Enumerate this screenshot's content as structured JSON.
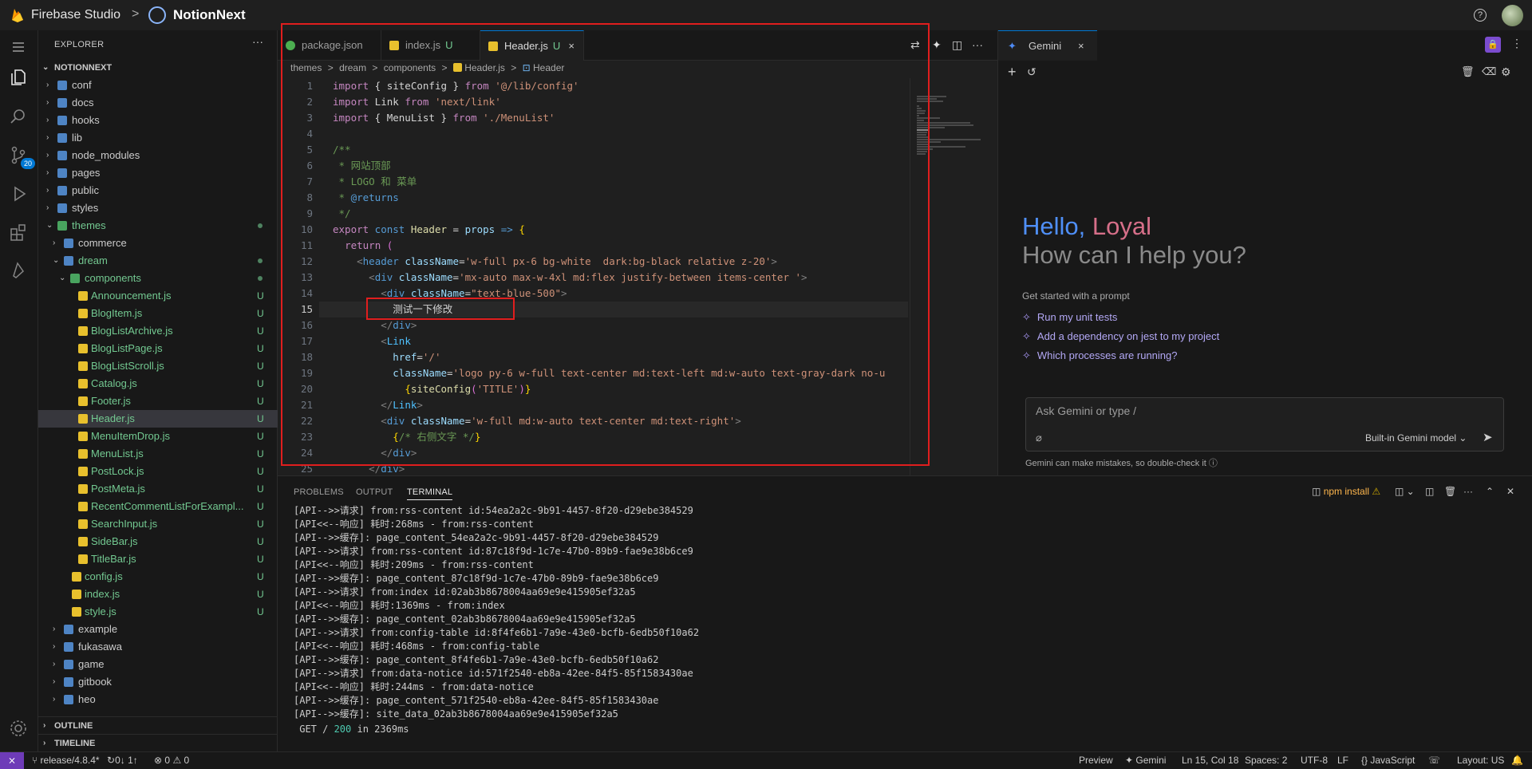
{
  "titlebar": {
    "brand": "Firebase Studio",
    "separator": ">",
    "project": "NotionNext",
    "help_icon": "help-circle-icon"
  },
  "explorer": {
    "header": "EXPLORER",
    "root": "NOTIONNEXT",
    "items": [
      {
        "label": "conf",
        "type": "folder",
        "depth": 1,
        "open": false,
        "status": ""
      },
      {
        "label": "docs",
        "type": "folder",
        "depth": 1,
        "open": false,
        "status": ""
      },
      {
        "label": "hooks",
        "type": "folder",
        "depth": 1,
        "open": false,
        "status": ""
      },
      {
        "label": "lib",
        "type": "folder",
        "depth": 1,
        "open": false,
        "status": ""
      },
      {
        "label": "node_modules",
        "type": "folder",
        "depth": 1,
        "open": false,
        "status": ""
      },
      {
        "label": "pages",
        "type": "folder",
        "depth": 1,
        "open": false,
        "status": ""
      },
      {
        "label": "public",
        "type": "folder",
        "depth": 1,
        "open": false,
        "status": ""
      },
      {
        "label": "styles",
        "type": "folder",
        "depth": 1,
        "open": false,
        "status": ""
      },
      {
        "label": "themes",
        "type": "folder",
        "depth": 1,
        "open": true,
        "status": "dot"
      },
      {
        "label": "commerce",
        "type": "folder",
        "depth": 2,
        "open": false,
        "status": ""
      },
      {
        "label": "dream",
        "type": "folder",
        "depth": 2,
        "open": true,
        "status": "dot"
      },
      {
        "label": "components",
        "type": "folder",
        "depth": 3,
        "open": true,
        "status": "dot"
      },
      {
        "label": "Announcement.js",
        "type": "js",
        "depth": 4,
        "status": "U"
      },
      {
        "label": "BlogItem.js",
        "type": "js",
        "depth": 4,
        "status": "U"
      },
      {
        "label": "BlogListArchive.js",
        "type": "js",
        "depth": 4,
        "status": "U"
      },
      {
        "label": "BlogListPage.js",
        "type": "js",
        "depth": 4,
        "status": "U"
      },
      {
        "label": "BlogListScroll.js",
        "type": "js",
        "depth": 4,
        "status": "U"
      },
      {
        "label": "Catalog.js",
        "type": "js",
        "depth": 4,
        "status": "U"
      },
      {
        "label": "Footer.js",
        "type": "js",
        "depth": 4,
        "status": "U"
      },
      {
        "label": "Header.js",
        "type": "js",
        "depth": 4,
        "status": "U",
        "selected": true
      },
      {
        "label": "MenuItemDrop.js",
        "type": "js",
        "depth": 4,
        "status": "U"
      },
      {
        "label": "MenuList.js",
        "type": "js",
        "depth": 4,
        "status": "U"
      },
      {
        "label": "PostLock.js",
        "type": "js",
        "depth": 4,
        "status": "U"
      },
      {
        "label": "PostMeta.js",
        "type": "js",
        "depth": 4,
        "status": "U"
      },
      {
        "label": "RecentCommentListForExampl...",
        "type": "js",
        "depth": 4,
        "status": "U"
      },
      {
        "label": "SearchInput.js",
        "type": "js",
        "depth": 4,
        "status": "U"
      },
      {
        "label": "SideBar.js",
        "type": "js",
        "depth": 4,
        "status": "U"
      },
      {
        "label": "TitleBar.js",
        "type": "js",
        "depth": 4,
        "status": "U"
      },
      {
        "label": "config.js",
        "type": "js",
        "depth": 3,
        "status": "U"
      },
      {
        "label": "index.js",
        "type": "js",
        "depth": 3,
        "status": "U"
      },
      {
        "label": "style.js",
        "type": "js",
        "depth": 3,
        "status": "U"
      },
      {
        "label": "example",
        "type": "folder",
        "depth": 2,
        "open": false,
        "status": ""
      },
      {
        "label": "fukasawa",
        "type": "folder",
        "depth": 2,
        "open": false,
        "status": ""
      },
      {
        "label": "game",
        "type": "folder",
        "depth": 2,
        "open": false,
        "status": ""
      },
      {
        "label": "gitbook",
        "type": "folder",
        "depth": 2,
        "open": false,
        "status": ""
      },
      {
        "label": "heo",
        "type": "folder",
        "depth": 2,
        "open": false,
        "status": ""
      }
    ],
    "outline": "OUTLINE",
    "timeline": "TIMELINE",
    "scm_badge": "20"
  },
  "editor": {
    "tabs": [
      {
        "label": "package.json",
        "badge": "",
        "active": false
      },
      {
        "label": "index.js",
        "badge": "U",
        "active": false
      },
      {
        "label": "Header.js",
        "badge": "U",
        "active": true,
        "close": "×"
      }
    ],
    "breadcrumb": [
      "themes",
      "dream",
      "components",
      "Header.js",
      "Header"
    ],
    "breadcrumb_sep": ">",
    "current_line": 15,
    "lines": [
      [
        [
          "kw",
          "import"
        ],
        [
          "pl",
          " { siteConfig } "
        ],
        [
          "kw",
          "from"
        ],
        [
          "str",
          " '@/lib/config'"
        ]
      ],
      [
        [
          "kw",
          "import"
        ],
        [
          "pl",
          " Link "
        ],
        [
          "kw",
          "from"
        ],
        [
          "str",
          " 'next/link'"
        ]
      ],
      [
        [
          "kw",
          "import"
        ],
        [
          "pl",
          " { MenuList } "
        ],
        [
          "kw",
          "from"
        ],
        [
          "str",
          " './MenuList'"
        ]
      ],
      [],
      [
        [
          "cm",
          "/**"
        ]
      ],
      [
        [
          "cm",
          " * 网站顶部"
        ]
      ],
      [
        [
          "cm",
          " * LOGO 和 菜单"
        ]
      ],
      [
        [
          "cm",
          " * "
        ],
        [
          "kw2",
          "@returns"
        ]
      ],
      [
        [
          "cm",
          " */"
        ]
      ],
      [
        [
          "kw",
          "export"
        ],
        [
          "kw2",
          " const"
        ],
        [
          "fn",
          " Header"
        ],
        [
          "pl",
          " = "
        ],
        [
          "attr",
          "props"
        ],
        [
          "kw2",
          " =>"
        ],
        [
          "pl",
          " "
        ],
        [
          "br",
          "{"
        ]
      ],
      [
        [
          "pl",
          "  "
        ],
        [
          "kw",
          "return"
        ],
        [
          "pl",
          " "
        ],
        [
          "br2",
          "("
        ]
      ],
      [
        [
          "pl",
          "    "
        ],
        [
          "jsxk",
          "<"
        ],
        [
          "tag",
          "header"
        ],
        [
          "attr",
          " className"
        ],
        [
          "pl",
          "="
        ],
        [
          "str",
          "'w-full px-6 bg-white  dark:bg-black relative z-20'"
        ],
        [
          "jsxk",
          ">"
        ]
      ],
      [
        [
          "pl",
          "      "
        ],
        [
          "jsxk",
          "<"
        ],
        [
          "tag",
          "div"
        ],
        [
          "attr",
          " className"
        ],
        [
          "pl",
          "="
        ],
        [
          "str",
          "'mx-auto max-w-4xl md:flex justify-between items-center '"
        ],
        [
          "jsxk",
          ">"
        ]
      ],
      [
        [
          "pl",
          "        "
        ],
        [
          "jsxk",
          "<"
        ],
        [
          "tag",
          "div"
        ],
        [
          "attr",
          " className"
        ],
        [
          "pl",
          "="
        ],
        [
          "str",
          "\"text-blue-500\""
        ],
        [
          "jsxk",
          ">"
        ]
      ],
      [
        [
          "pl",
          "          测试一下修改"
        ]
      ],
      [
        [
          "pl",
          "        "
        ],
        [
          "jsxk",
          "</"
        ],
        [
          "tag",
          "div"
        ],
        [
          "jsxk",
          ">"
        ]
      ],
      [
        [
          "pl",
          "        "
        ],
        [
          "jsxk",
          "<"
        ],
        [
          "var",
          "Link"
        ]
      ],
      [
        [
          "pl",
          "          "
        ],
        [
          "attr",
          "href"
        ],
        [
          "pl",
          "="
        ],
        [
          "str",
          "'/'"
        ]
      ],
      [
        [
          "pl",
          "          "
        ],
        [
          "attr",
          "className"
        ],
        [
          "pl",
          "="
        ],
        [
          "str",
          "'logo py-6 w-full text-center md:text-left md:w-auto text-gray-dark no-u"
        ]
      ],
      [
        [
          "pl",
          "            "
        ],
        [
          "br",
          "{"
        ],
        [
          "fn",
          "siteConfig"
        ],
        [
          "br2",
          "("
        ],
        [
          "str",
          "'TITLE'"
        ],
        [
          "br2",
          ")"
        ],
        [
          "br",
          "}"
        ]
      ],
      [
        [
          "pl",
          "        "
        ],
        [
          "jsxk",
          "</"
        ],
        [
          "var",
          "Link"
        ],
        [
          "jsxk",
          ">"
        ]
      ],
      [
        [
          "pl",
          "        "
        ],
        [
          "jsxk",
          "<"
        ],
        [
          "tag",
          "div"
        ],
        [
          "attr",
          " className"
        ],
        [
          "pl",
          "="
        ],
        [
          "str",
          "'w-full md:w-auto text-center md:text-right'"
        ],
        [
          "jsxk",
          ">"
        ]
      ],
      [
        [
          "pl",
          "          "
        ],
        [
          "br",
          "{"
        ],
        [
          "cm",
          "/* 右侧文字 */"
        ],
        [
          "br",
          "}"
        ]
      ],
      [
        [
          "pl",
          "        "
        ],
        [
          "jsxk",
          "</"
        ],
        [
          "tag",
          "div"
        ],
        [
          "jsxk",
          ">"
        ]
      ],
      [
        [
          "pl",
          "      "
        ],
        [
          "jsxk",
          "</"
        ],
        [
          "tag",
          "div"
        ],
        [
          "jsxk",
          ">"
        ]
      ]
    ]
  },
  "gemini": {
    "tab_label": "Gemini",
    "hello": "Hello,",
    "name": "Loyal",
    "subtitle": "How can I help you?",
    "started": "Get started with a prompt",
    "prompts": [
      "Run my unit tests",
      "Add a dependency on jest to my project",
      "Which processes are running?"
    ],
    "input_placeholder": "Ask Gemini or type /",
    "model": "Built-in Gemini model",
    "disclaimer": "Gemini can make mistakes, so double-check it"
  },
  "panel": {
    "tabs": [
      "PROBLEMS",
      "OUTPUT",
      "TERMINAL"
    ],
    "active_tab": "TERMINAL",
    "task": "npm install",
    "terminal_lines": [
      "[API-->>请求] from:rss-content id:54ea2a2c-9b91-4457-8f20-d29ebe384529",
      "[API<<--响应] 耗时:268ms - from:rss-content",
      "[API-->>缓存]: page_content_54ea2a2c-9b91-4457-8f20-d29ebe384529",
      "[API-->>请求] from:rss-content id:87c18f9d-1c7e-47b0-89b9-fae9e38b6ce9",
      "[API<<--响应] 耗时:209ms - from:rss-content",
      "[API-->>缓存]: page_content_87c18f9d-1c7e-47b0-89b9-fae9e38b6ce9",
      "[API-->>请求] from:index id:02ab3b8678004aa69e9e415905ef32a5",
      "[API<<--响应] 耗时:1369ms - from:index",
      "[API-->>缓存]: page_content_02ab3b8678004aa69e9e415905ef32a5",
      "[API-->>请求] from:config-table id:8f4fe6b1-7a9e-43e0-bcfb-6edb50f10a62",
      "[API<<--响应] 耗时:468ms - from:config-table",
      "[API-->>缓存]: page_content_8f4fe6b1-7a9e-43e0-bcfb-6edb50f10a62",
      "[API-->>请求] from:data-notice id:571f2540-eb8a-42ee-84f5-85f1583430ae",
      "[API<<--响应] 耗时:244ms - from:data-notice",
      "[API-->>缓存]: page_content_571f2540-eb8a-42ee-84f5-85f1583430ae",
      "[API-->>缓存]: site_data_02ab3b8678004aa69e9e415905ef32a5"
    ],
    "last_line": {
      "prefix": " GET / ",
      "code": "200",
      "suffix": " in 2369ms"
    }
  },
  "statusbar": {
    "remote": "⨯",
    "branch": "release/4.8.4*",
    "sync": "0↓ 1↑",
    "problems": "0",
    "warnings": "0",
    "preview": "Preview",
    "gemini": "Gemini",
    "position": "Ln 15, Col 18",
    "spaces": "Spaces: 2",
    "encoding": "UTF-8",
    "eol": "LF",
    "language": "JavaScript",
    "layout": "Layout: US"
  },
  "colors": {
    "accent": "#0078d4",
    "annotation_red": "#e01e1e",
    "untracked": "#73c991",
    "gemini_blue": "#4f8ff7",
    "gemini_pink": "#d66f89"
  }
}
